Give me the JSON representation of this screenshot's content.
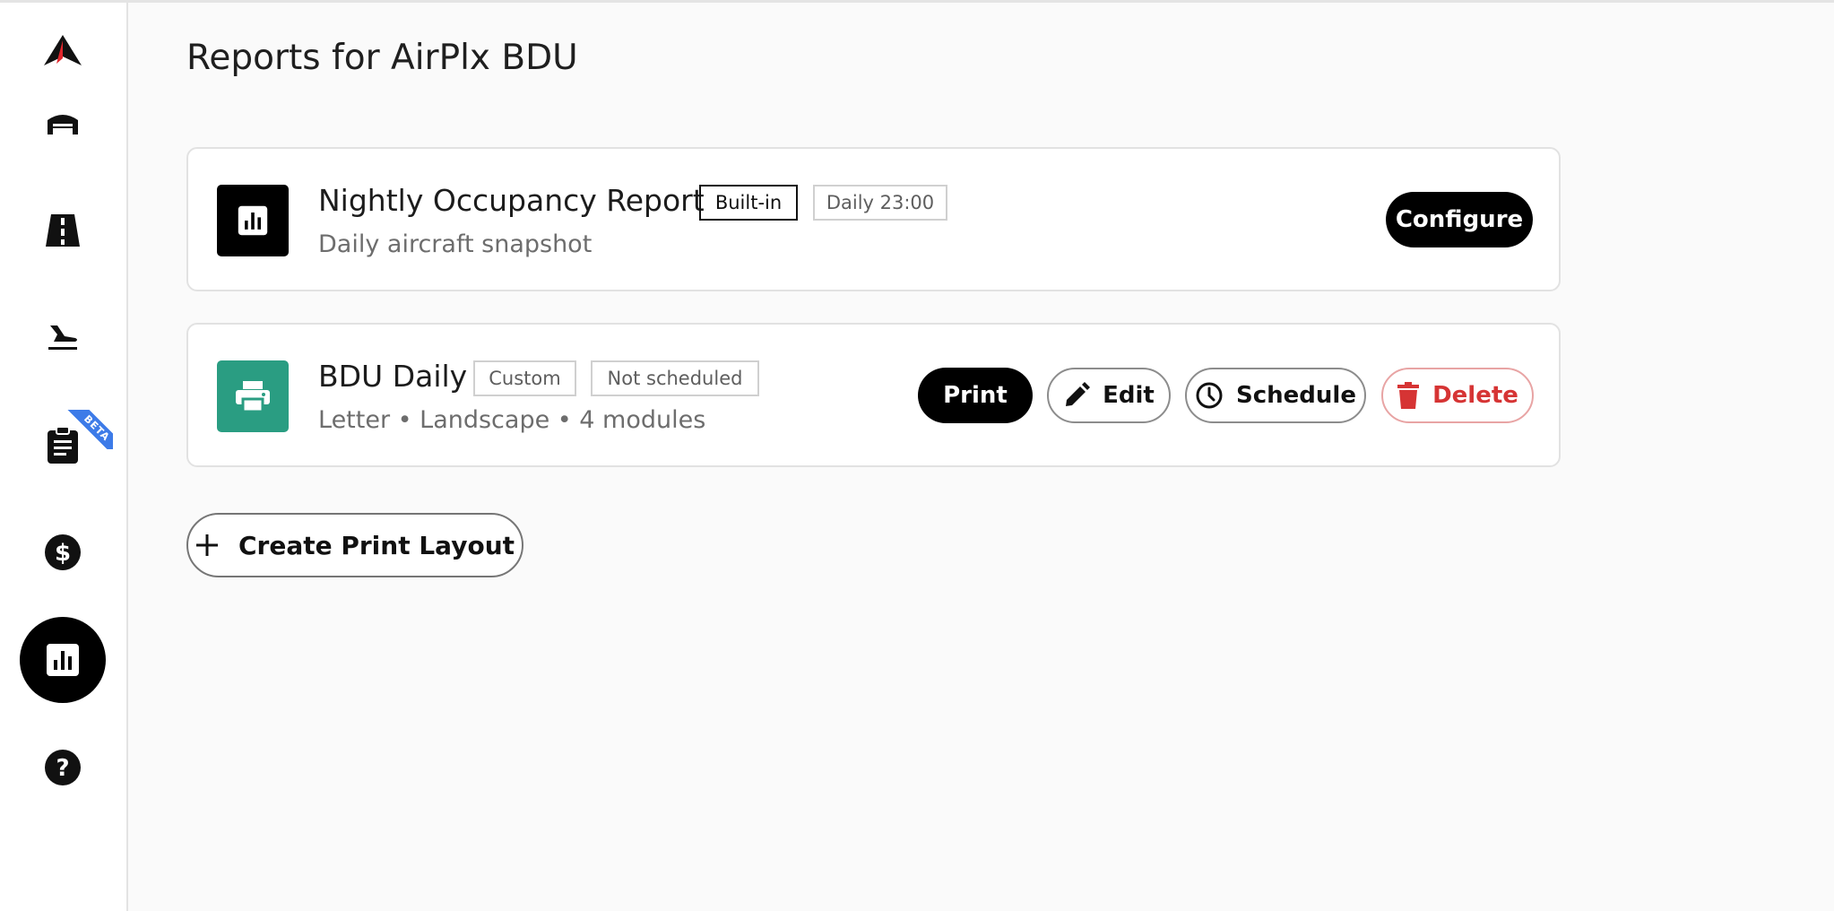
{
  "page": {
    "title": "Reports for AirPlx BDU"
  },
  "sidebar": {
    "beta_badge": "BETA",
    "items": [
      {
        "icon": "airplx-logo-icon"
      },
      {
        "icon": "hangar-icon"
      },
      {
        "icon": "road-icon"
      },
      {
        "icon": "plane-landing-icon"
      },
      {
        "icon": "clipboard-icon"
      },
      {
        "icon": "dollar-icon"
      },
      {
        "icon": "bar-chart-icon",
        "active": true
      },
      {
        "icon": "help-icon"
      }
    ]
  },
  "reports": [
    {
      "title": "Nightly Occupancy Report",
      "tags": [
        "Built-in",
        "Daily 23:00"
      ],
      "subtitle": "Daily aircraft snapshot",
      "icon": "bar-chart-icon",
      "actions": {
        "configure": "Configure"
      }
    },
    {
      "title": "BDU Daily",
      "tags": [
        "Custom",
        "Not scheduled"
      ],
      "subtitle": "Letter • Landscape • 4 modules",
      "icon": "printer-icon",
      "icon_color": "#2a9d82",
      "actions": {
        "print": "Print",
        "edit": "Edit",
        "schedule": "Schedule",
        "delete": "Delete"
      }
    }
  ],
  "create_button": {
    "label": "Create Print Layout"
  },
  "colors": {
    "accent_green": "#2a9d82",
    "danger": "#d63434",
    "beta_blue": "#3d7be8"
  }
}
